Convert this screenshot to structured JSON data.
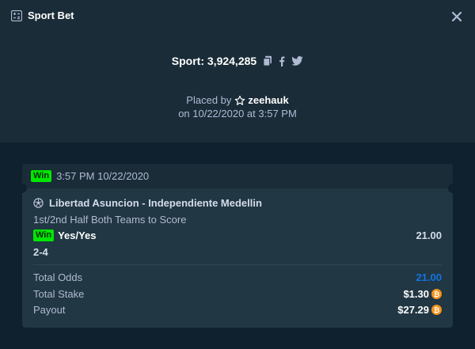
{
  "header": {
    "title": "Sport Bet",
    "icon": "bet-slip-icon",
    "close_icon": "close-icon"
  },
  "bet": {
    "id_label": "Sport: 3,924,285",
    "share_icons": [
      "copy-icon",
      "facebook-icon",
      "twitter-icon"
    ],
    "placed_by_label": "Placed by",
    "username": "zeehauk",
    "user_icon": "star-outline-icon",
    "placed_on": "on 10/22/2020 at 3:57 PM"
  },
  "card": {
    "status_badge": "Win",
    "timestamp": "3:57 PM 10/22/2020",
    "match_icon": "soccer-ball-icon",
    "match": "Libertad Asuncion - Independiente Medellin",
    "market": "1st/2nd Half Both Teams to Score",
    "selection_badge": "Win",
    "selection": "Yes/Yes",
    "selection_odds": "21.00",
    "score": "2-4"
  },
  "summary": {
    "total_odds_label": "Total Odds",
    "total_odds": "21.00",
    "total_stake_label": "Total Stake",
    "total_stake": "$1.30",
    "payout_label": "Payout",
    "payout": "$27.29",
    "currency_icon": "bitcoin-icon",
    "currency_glyph": "₿"
  },
  "colors": {
    "background": "#0f212e",
    "panel": "#1a2c38",
    "card": "#213743",
    "win_green": "#00e701",
    "odds_blue": "#1475e1",
    "coin_orange": "#f7931a"
  }
}
